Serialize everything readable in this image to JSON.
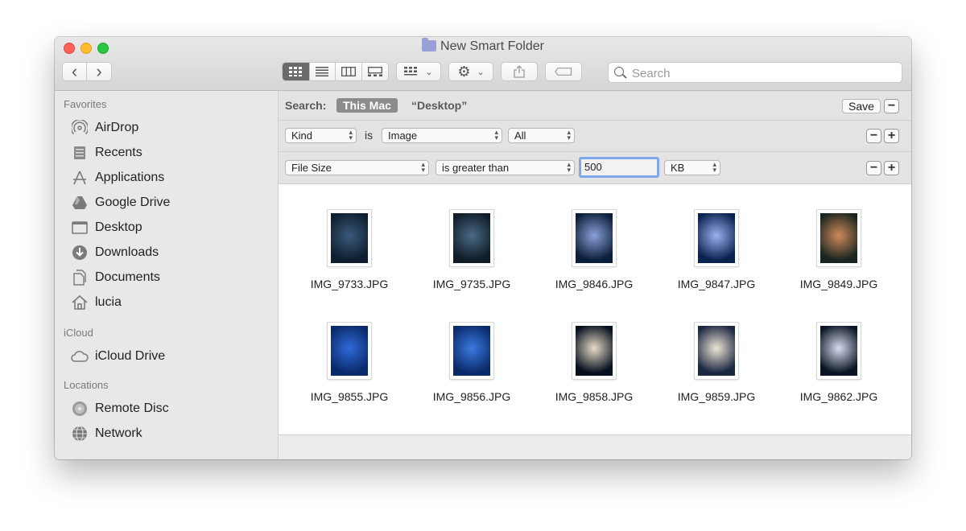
{
  "window": {
    "title": "New Smart Folder"
  },
  "toolbar": {
    "back_glyph": "‹",
    "forward_glyph": "›",
    "view_icons": [
      "icon-view-icon",
      "list-view-icon",
      "column-view-icon",
      "gallery-view-icon"
    ],
    "group_icon": "group-icon",
    "action_icon": "gear-icon",
    "share_icon": "share-icon",
    "tag_icon": "tag-icon",
    "search_placeholder": "Search"
  },
  "sidebar": {
    "sections": [
      {
        "title": "Favorites",
        "items": [
          {
            "label": "AirDrop",
            "icon": "airdrop-icon"
          },
          {
            "label": "Recents",
            "icon": "recents-icon"
          },
          {
            "label": "Applications",
            "icon": "applications-icon"
          },
          {
            "label": "Google Drive",
            "icon": "google-drive-icon"
          },
          {
            "label": "Desktop",
            "icon": "desktop-icon"
          },
          {
            "label": "Downloads",
            "icon": "downloads-icon"
          },
          {
            "label": "Documents",
            "icon": "documents-icon"
          },
          {
            "label": "lucia",
            "icon": "home-icon"
          }
        ]
      },
      {
        "title": "iCloud",
        "items": [
          {
            "label": "iCloud Drive",
            "icon": "icloud-icon"
          }
        ]
      },
      {
        "title": "Locations",
        "items": [
          {
            "label": "Remote Disc",
            "icon": "disc-icon"
          },
          {
            "label": "Network",
            "icon": "network-icon"
          }
        ]
      }
    ]
  },
  "search_bar": {
    "label": "Search:",
    "scope_active": "This Mac",
    "scope_other": "“Desktop”",
    "save_label": "Save",
    "minus": "−",
    "plus": "+"
  },
  "criteria": [
    {
      "attribute": "Kind",
      "connector": "is",
      "operator": "Image",
      "value": "All"
    },
    {
      "attribute": "File Size",
      "operator": "is greater than",
      "value": "500",
      "unit": "KB"
    }
  ],
  "files": [
    {
      "name": "IMG_9733.JPG",
      "colors": [
        "#0e1e2e",
        "#3a5a7a"
      ]
    },
    {
      "name": "IMG_9735.JPG",
      "colors": [
        "#101c28",
        "#4a6a84"
      ]
    },
    {
      "name": "IMG_9846.JPG",
      "colors": [
        "#0b1f3a",
        "#8aa0d8"
      ]
    },
    {
      "name": "IMG_9847.JPG",
      "colors": [
        "#0a2250",
        "#9db0f0"
      ]
    },
    {
      "name": "IMG_9849.JPG",
      "colors": [
        "#1a2520",
        "#d08a5a"
      ]
    },
    {
      "name": "IMG_9855.JPG",
      "colors": [
        "#0a2a6a",
        "#2f6ad8"
      ]
    },
    {
      "name": "IMG_9856.JPG",
      "colors": [
        "#0b2a6a",
        "#3a7ae0"
      ]
    },
    {
      "name": "IMG_9858.JPG",
      "colors": [
        "#06101e",
        "#e8dcc8"
      ]
    },
    {
      "name": "IMG_9859.JPG",
      "colors": [
        "#1a2740",
        "#f0e6d8"
      ]
    },
    {
      "name": "IMG_9862.JPG",
      "colors": [
        "#0a1424",
        "#d8dcf0"
      ]
    }
  ]
}
